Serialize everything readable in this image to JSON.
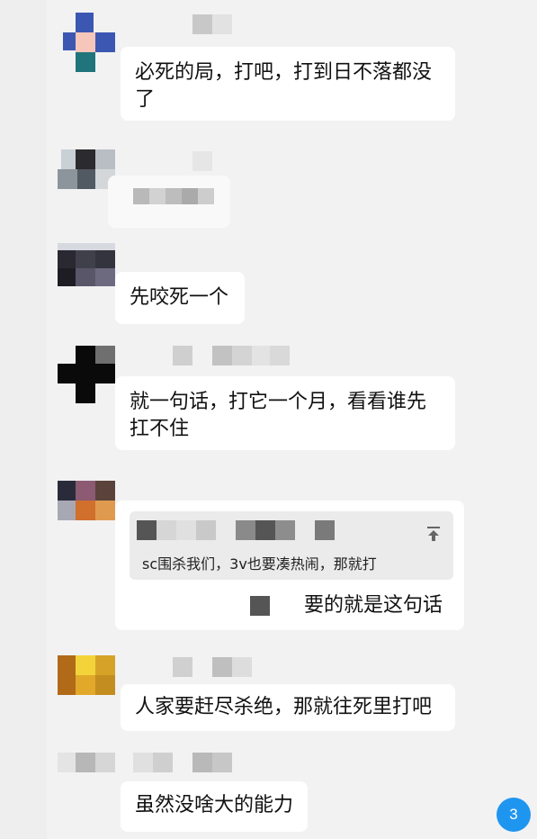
{
  "messages": [
    {
      "text": "必死的局，打吧，打到日不落都没了"
    },
    {
      "text": ""
    },
    {
      "text": "先咬死一个"
    },
    {
      "text": "就一句话，打它一个月，看看谁先扛不住"
    },
    {
      "quote_text": "sc围杀我们，3v也要凑热闹，那就打",
      "text": "要的就是这句话"
    },
    {
      "text": "人家要赶尽杀绝，那就往死里打吧"
    },
    {
      "text": "虽然没啥大的能力"
    }
  ],
  "unread_badge": "3",
  "colors": {
    "badge": "#1e96f0",
    "bubble": "#ffffff",
    "background": "#f2f2f3"
  },
  "icons": {
    "quote_action": "pin-top-icon",
    "sender_avatar": "avatar-icon"
  }
}
